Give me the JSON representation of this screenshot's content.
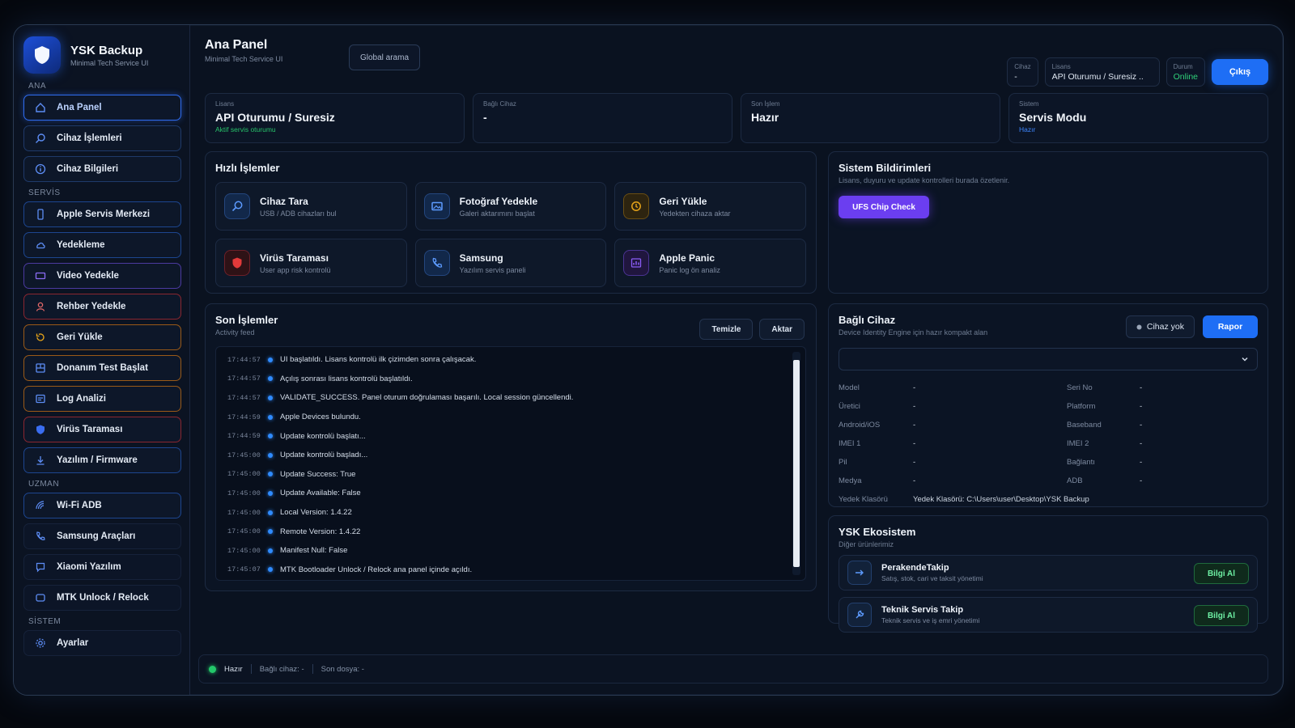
{
  "brand": {
    "title": "YSK Backup",
    "subtitle": "Minimal Tech Service UI"
  },
  "sidebar": {
    "sections": {
      "ana": "ANA",
      "servis": "SERVİS",
      "uzman": "UZMAN",
      "sistem": "SİSTEM"
    },
    "items": [
      {
        "label": "Ana Panel",
        "icon": "home-icon"
      },
      {
        "label": "Cihaz İşlemleri",
        "icon": "search-icon"
      },
      {
        "label": "Cihaz Bilgileri",
        "icon": "info-icon"
      },
      {
        "label": "Apple Servis Merkezi",
        "icon": "phone-icon"
      },
      {
        "label": "Yedekleme",
        "icon": "cloud-icon"
      },
      {
        "label": "Video Yedekle",
        "icon": "video-icon"
      },
      {
        "label": "Rehber Yedekle",
        "icon": "user-icon"
      },
      {
        "label": "Geri Yükle",
        "icon": "restore-icon"
      },
      {
        "label": "Donanım Test Başlat",
        "icon": "hardware-icon"
      },
      {
        "label": "Log Analizi",
        "icon": "log-icon"
      },
      {
        "label": "Virüs Taraması",
        "icon": "shield-icon"
      },
      {
        "label": "Yazılım / Firmware",
        "icon": "download-icon"
      },
      {
        "label": "Wi-Fi ADB",
        "icon": "wifi-icon"
      },
      {
        "label": "Samsung Araçları",
        "icon": "phone-call-icon"
      },
      {
        "label": "Xiaomi Yazılım",
        "icon": "chat-icon"
      },
      {
        "label": "MTK Unlock / Relock",
        "icon": "chip-icon"
      },
      {
        "label": "Ayarlar",
        "icon": "gear-icon"
      }
    ]
  },
  "header": {
    "title": "Ana Panel",
    "subtitle": "Minimal Tech Service UI",
    "search_label": "Global arama",
    "chips": {
      "cihaz_k": "Cihaz",
      "cihaz_v": "-",
      "lisans_k": "Lisans",
      "lisans_v": "API Oturumu / Suresiz ..",
      "durum_k": "Durum",
      "durum_v": "Online"
    },
    "logout_label": "Çıkış"
  },
  "stats": [
    {
      "k": "Lisans",
      "v": "API Oturumu / Suresiz",
      "s": "Aktif servis oturumu"
    },
    {
      "k": "Bağlı Cihaz",
      "v": "-",
      "s": ""
    },
    {
      "k": "Son İşlem",
      "v": "Hazır",
      "s": ""
    },
    {
      "k": "Sistem",
      "v": "Servis Modu",
      "s": "Hazır"
    }
  ],
  "quick": {
    "title": "Hızlı İşlemler",
    "items": [
      {
        "title": "Cihaz Tara",
        "sub": "USB / ADB cihazları bul",
        "icon": "search-icon",
        "color": "#2f7cff"
      },
      {
        "title": "Fotoğraf Yedekle",
        "sub": "Galeri aktarımını başlat",
        "icon": "image-icon",
        "color": "#2f7cff"
      },
      {
        "title": "Geri Yükle",
        "sub": "Yedekten cihaza aktar",
        "icon": "restore-icon",
        "color": "#e3a21a"
      },
      {
        "title": "Virüs Taraması",
        "sub": "User app risk kontrolü",
        "icon": "shield-icon",
        "color": "#e23a3a"
      },
      {
        "title": "Samsung",
        "sub": "Yazılım servis paneli",
        "icon": "phone-call-icon",
        "color": "#2f7cff"
      },
      {
        "title": "Apple Panic",
        "sub": "Panic log ön analiz",
        "icon": "chart-icon",
        "color": "#8a5cf6"
      }
    ]
  },
  "notifications": {
    "title": "Sistem Bildirimleri",
    "sub": "Lisans, duyuru ve update kontrolleri burada özetlenir.",
    "button": "UFS Chip Check"
  },
  "activity": {
    "title": "Son İşlemler",
    "sub": "Activity feed",
    "clear_label": "Temizle",
    "export_label": "Aktar",
    "logs": [
      {
        "time": "17:44:57",
        "msg": "UI başlatıldı. Lisans kontrolü ilk çizimden sonra çalışacak."
      },
      {
        "time": "17:44:57",
        "msg": "Açılış sonrası lisans kontrolü başlatıldı."
      },
      {
        "time": "17:44:57",
        "msg": "VALIDATE_SUCCESS. Panel oturum doğrulaması başarılı. Local session güncellendi."
      },
      {
        "time": "17:44:59",
        "msg": "Apple Devices bulundu."
      },
      {
        "time": "17:44:59",
        "msg": "Update kontrolü başlatı..."
      },
      {
        "time": "17:45:00",
        "msg": "Update kontrolü başladı..."
      },
      {
        "time": "17:45:00",
        "msg": "Update Success: True"
      },
      {
        "time": "17:45:00",
        "msg": "Update Available: False"
      },
      {
        "time": "17:45:00",
        "msg": "Local Version: 1.4.22"
      },
      {
        "time": "17:45:00",
        "msg": "Remote Version: 1.4.22"
      },
      {
        "time": "17:45:00",
        "msg": "Manifest Null: False"
      },
      {
        "time": "17:45:07",
        "msg": "MTK Bootloader Unlock / Relock ana panel içinde açıldı."
      }
    ]
  },
  "device": {
    "title": "Bağlı Cihaz",
    "sub": "Device Identity Engine için hazır kompakt alan",
    "status_label": "Cihaz yok",
    "report_label": "Rapor",
    "left": [
      {
        "k": "Model",
        "v": "-"
      },
      {
        "k": "Üretici",
        "v": "-"
      },
      {
        "k": "Android/iOS",
        "v": "-"
      },
      {
        "k": "IMEI 1",
        "v": "-"
      },
      {
        "k": "Pil",
        "v": "-"
      },
      {
        "k": "Medya",
        "v": "-"
      }
    ],
    "right": [
      {
        "k": "Seri No",
        "v": "-"
      },
      {
        "k": "Platform",
        "v": "-"
      },
      {
        "k": "Baseband",
        "v": "-"
      },
      {
        "k": "IMEI 2",
        "v": "-"
      },
      {
        "k": "Bağlantı",
        "v": "-"
      },
      {
        "k": "ADB",
        "v": "-"
      }
    ],
    "backup_k": "Yedek Klasörü",
    "backup_v": "Yedek Klasörü: C:\\Users\\user\\Desktop\\YSK Backup"
  },
  "ecosystem": {
    "title": "YSK Ekosistem",
    "sub": "Diğer ürünlerimiz",
    "items": [
      {
        "title": "PerakendeTakip",
        "sub": "Satış, stok, cari ve taksit yönetimi",
        "button": "Bilgi Al",
        "icon": "arrow-icon"
      },
      {
        "title": "Teknik Servis Takip",
        "sub": "Teknik servis ve iş emri yönetimi",
        "button": "Bilgi Al",
        "icon": "wrench-icon"
      }
    ]
  },
  "statusbar": {
    "state": "Hazır",
    "device": "Bağlı cihaz: -",
    "file": "Son dosya: -"
  }
}
